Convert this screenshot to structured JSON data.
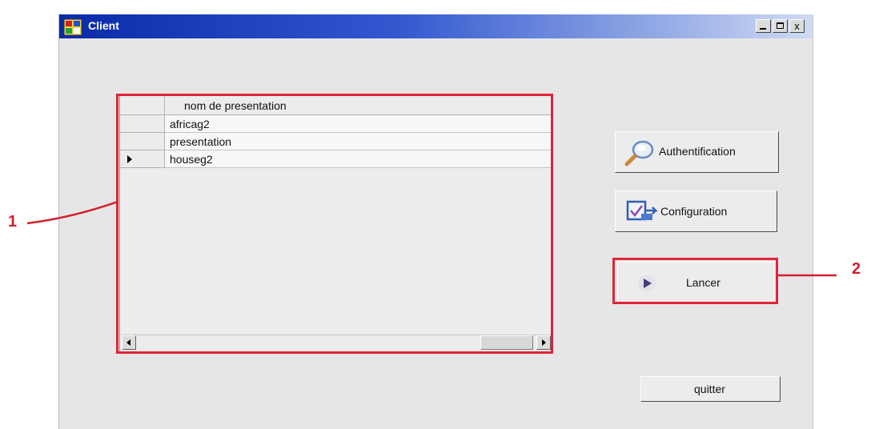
{
  "window": {
    "title": "Client",
    "controls": {
      "minimize": "minimize",
      "maximize": "maximize",
      "close": "x"
    }
  },
  "grid": {
    "column_header": "nom de presentation",
    "rows": [
      {
        "value": "africag2",
        "current": false
      },
      {
        "value": "presentation",
        "current": false
      },
      {
        "value": "houseg2",
        "current": true
      }
    ]
  },
  "buttons": {
    "authentification": "Authentification",
    "configuration": "Configuration",
    "lancer": "Lancer",
    "quitter": "quitter"
  },
  "annotations": {
    "label_1": "1",
    "label_2": "2",
    "color": "#e0243a"
  },
  "icons": {
    "app": "app-window-icon",
    "authentification": "magnifier-icon",
    "configuration": "config-check-icon",
    "lancer": "play-icon"
  }
}
